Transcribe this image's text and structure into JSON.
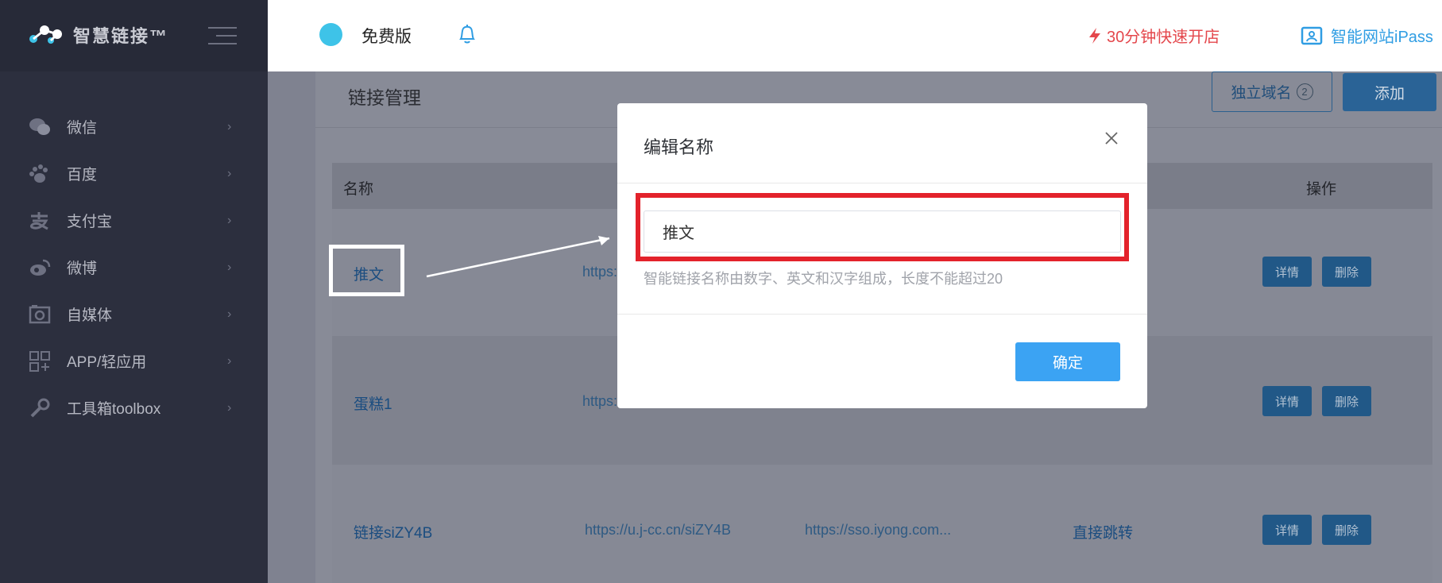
{
  "brand": {
    "name": "智慧链接™"
  },
  "header": {
    "edition": "免费版",
    "promo_open_store": "30分钟快速开店",
    "promo_ipass": "智能网站iPass"
  },
  "sidebar": {
    "items": [
      {
        "label": "微信",
        "icon": "wechat-icon"
      },
      {
        "label": "百度",
        "icon": "baidu-paw-icon"
      },
      {
        "label": "支付宝",
        "icon": "alipay-icon"
      },
      {
        "label": "微博",
        "icon": "weibo-icon"
      },
      {
        "label": "自媒体",
        "icon": "media-icon"
      },
      {
        "label": "APP/轻应用",
        "icon": "app-grid-icon"
      },
      {
        "label": "工具箱toolbox",
        "icon": "wrench-icon"
      }
    ],
    "arrow": "›"
  },
  "main": {
    "title": "链接管理",
    "domain_button": "独立域名",
    "domain_count": "2",
    "add_button": "添加",
    "columns": {
      "name": "名称",
      "actions": "操作"
    },
    "rows": [
      {
        "name": "推文",
        "short_url": "https:",
        "target": "",
        "type": ""
      },
      {
        "name": "蛋糕1",
        "short_url": "https:",
        "target": "",
        "type": ""
      },
      {
        "name": "链接siZY4B",
        "short_url": "https://u.j-cc.cn/siZY4B",
        "target": "https://sso.iyong.com...",
        "type": "直接跳转"
      }
    ],
    "detail_label": "详情",
    "delete_label": "删除"
  },
  "modal": {
    "title": "编辑名称",
    "input_value": "推文",
    "hint": "智能链接名称由数字、英文和汉字组成，长度不能超过20",
    "confirm": "确定"
  },
  "colors": {
    "sidebar_bg": "#2c2f3e",
    "primary": "#3ba3f3",
    "highlight_red": "#e3222b",
    "promo_red": "#e4474c",
    "link_blue": "#2f9de3"
  }
}
